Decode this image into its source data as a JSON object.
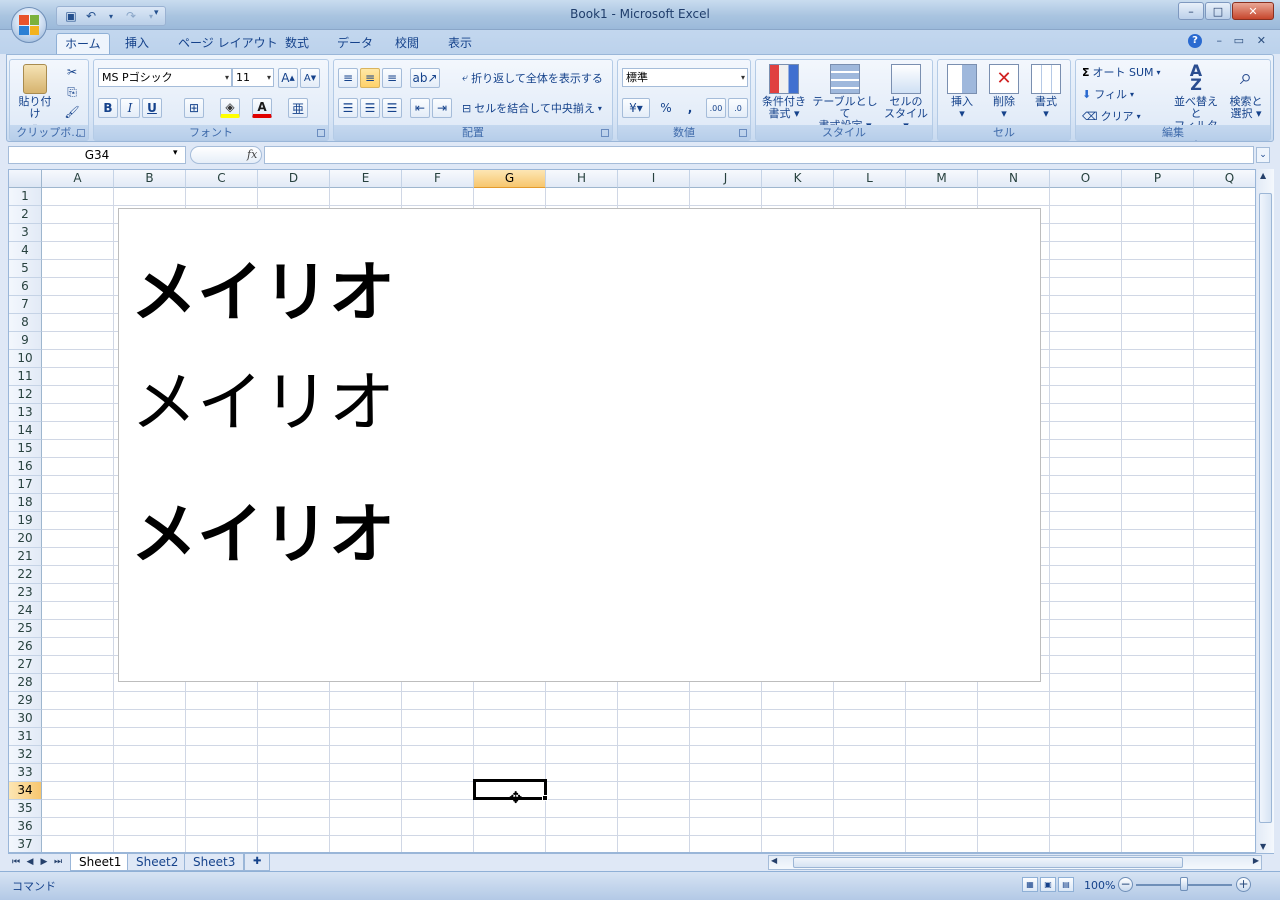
{
  "window": {
    "title": "Book1 - Microsoft Excel"
  },
  "tabs": [
    "ホーム",
    "挿入",
    "ページ レイアウト",
    "数式",
    "データ",
    "校閲",
    "表示"
  ],
  "clipboard": {
    "paste_label": "貼り付け",
    "group_label": "クリップボ..."
  },
  "font": {
    "name": "MS Pゴシック",
    "size": "11",
    "group_label": "フォント",
    "bold": "B",
    "italic": "I",
    "underline": "U"
  },
  "alignment": {
    "wrap_label": "折り返して全体を表示する",
    "merge_label": "セルを結合して中央揃え",
    "group_label": "配置"
  },
  "number": {
    "format": "標準",
    "group_label": "数値",
    "percent": "%",
    "comma": ","
  },
  "styles": {
    "conditional_label": "条件付き",
    "conditional_label2": "書式",
    "table_label": "テーブルとして",
    "table_label2": "書式設定",
    "cell_style_label": "セルの",
    "cell_style_label2": "スタイル",
    "group_label": "スタイル"
  },
  "cells": {
    "insert_label": "挿入",
    "delete_label": "削除",
    "format_label": "書式",
    "group_label": "セル"
  },
  "editing": {
    "autosum_label": "オート SUM",
    "fill_label": "フィル",
    "clear_label": "クリア",
    "sort_label": "並べ替えと",
    "sort_label2": "フィルタ",
    "find_label": "検索と",
    "find_label2": "選択",
    "group_label": "編集"
  },
  "formula_bar": {
    "name_box": "G34",
    "fx": "fx",
    "value": ""
  },
  "columns": [
    "A",
    "B",
    "C",
    "D",
    "E",
    "F",
    "G",
    "H",
    "I",
    "J",
    "K",
    "L",
    "M",
    "N",
    "O",
    "P",
    "Q"
  ],
  "active_column": "G",
  "rows": [
    "1",
    "2",
    "3",
    "4",
    "5",
    "6",
    "7",
    "8",
    "9",
    "10",
    "11",
    "12",
    "13",
    "14",
    "15",
    "16",
    "17",
    "18",
    "19",
    "20",
    "21",
    "22",
    "23",
    "24",
    "25",
    "26",
    "27",
    "28",
    "29",
    "30",
    "31",
    "32",
    "33",
    "34",
    "35",
    "36",
    "37"
  ],
  "active_row": "34",
  "textbox": {
    "lines": [
      "メイリオ",
      "メイリオ",
      "メイリオ"
    ]
  },
  "sheet_tabs": [
    "Sheet1",
    "Sheet2",
    "Sheet3"
  ],
  "status": {
    "mode": "コマンド",
    "zoom": "100%"
  }
}
